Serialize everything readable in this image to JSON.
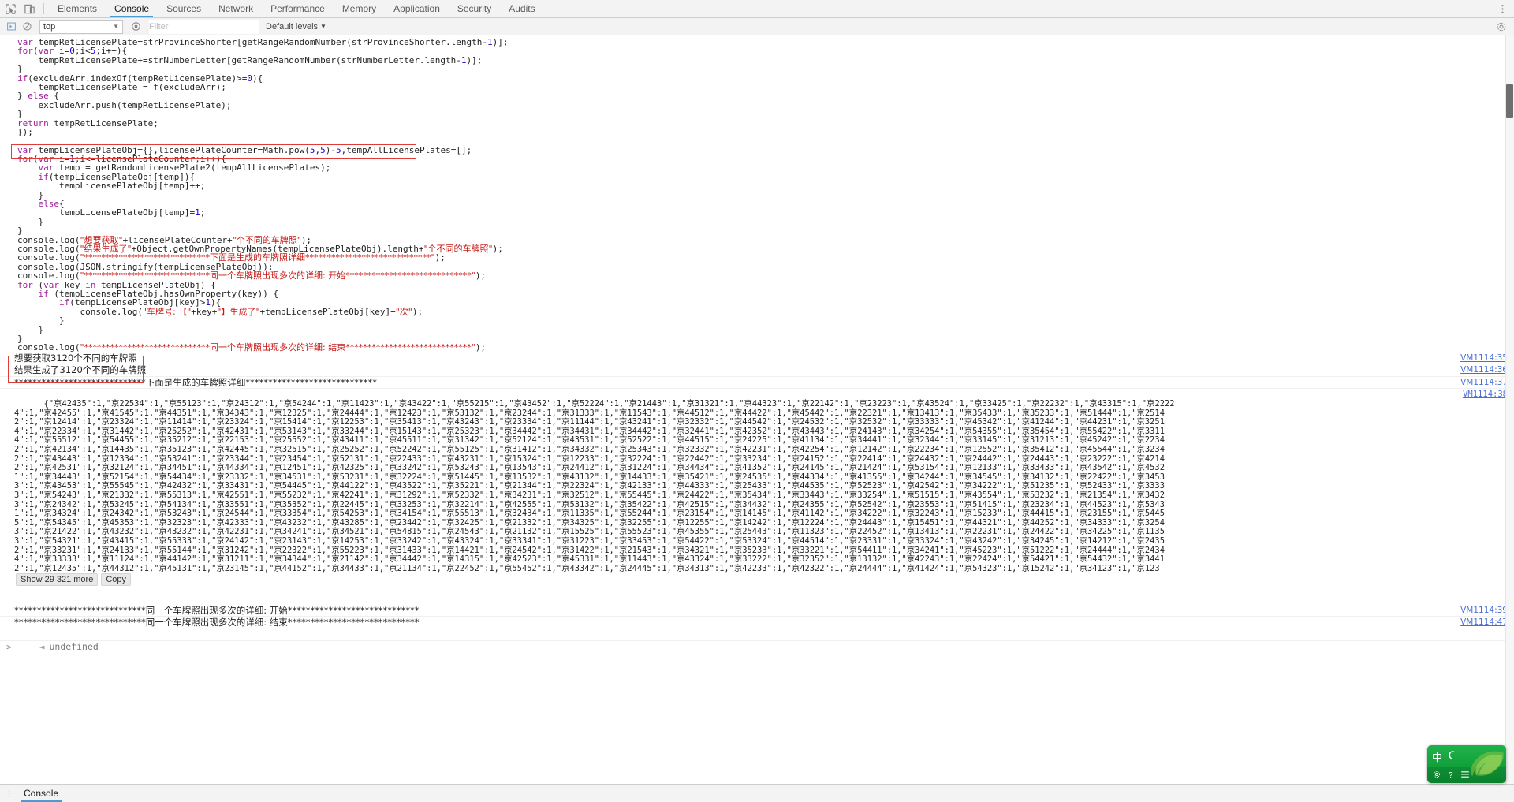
{
  "window": {
    "title": "Chrome DevTools - Console"
  },
  "toolbar_icons": {
    "inspect": "inspect-element-icon",
    "device": "device-toolbar-icon",
    "settings": "gear-icon",
    "more": "more-options-icon"
  },
  "tabs": [
    {
      "label": "Elements",
      "active": false
    },
    {
      "label": "Console",
      "active": true
    },
    {
      "label": "Sources",
      "active": false
    },
    {
      "label": "Network",
      "active": false
    },
    {
      "label": "Performance",
      "active": false
    },
    {
      "label": "Memory",
      "active": false
    },
    {
      "label": "Application",
      "active": false
    },
    {
      "label": "Security",
      "active": false
    },
    {
      "label": "Audits",
      "active": false
    }
  ],
  "console_toolbar": {
    "execute_label": "execute-context-icon",
    "clear_label": "clear-console-icon",
    "context_value": "top",
    "context_options": [
      "top"
    ],
    "eye_label": "live-expression-icon",
    "filter_placeholder": "Filter",
    "filter_value": "",
    "levels_label": "Default levels",
    "levels_caret": "▼",
    "settings_label": "gear-icon"
  },
  "code": {
    "highlight_line_index": 9,
    "lines": [
      [
        {
          "t": "var ",
          "c": "kw"
        },
        {
          "t": "tempRetLicensePlate=strProvinceShorter[getRangeRandomNumber(strProvinceShorter.length-",
          "c": "op"
        },
        {
          "t": "1",
          "c": "num"
        },
        {
          "t": ")];",
          "c": "op"
        }
      ],
      [
        {
          "t": "for",
          "c": "kw"
        },
        {
          "t": "(",
          "c": "op"
        },
        {
          "t": "var ",
          "c": "kw"
        },
        {
          "t": "i=",
          "c": "op"
        },
        {
          "t": "0",
          "c": "num"
        },
        {
          "t": ";i<",
          "c": "op"
        },
        {
          "t": "5",
          "c": "num"
        },
        {
          "t": ";i++){",
          "c": "op"
        }
      ],
      [
        {
          "t": "    tempRetLicensePlate+=strNumberLetter[getRangeRandomNumber(strNumberLetter.length-",
          "c": "op"
        },
        {
          "t": "1",
          "c": "num"
        },
        {
          "t": ")];",
          "c": "op"
        }
      ],
      [
        {
          "t": "}",
          "c": "op"
        }
      ],
      [
        {
          "t": "if",
          "c": "kw"
        },
        {
          "t": "(excludeArr.indexOf(tempRetLicensePlate)>=",
          "c": "op"
        },
        {
          "t": "0",
          "c": "num"
        },
        {
          "t": "){",
          "c": "op"
        }
      ],
      [
        {
          "t": "    tempRetLicensePlate = f(excludeArr);",
          "c": "op"
        }
      ],
      [
        {
          "t": "} ",
          "c": "op"
        },
        {
          "t": "else",
          "c": "kw"
        },
        {
          "t": " {",
          "c": "op"
        }
      ],
      [
        {
          "t": "    excludeArr.push(tempRetLicensePlate);",
          "c": "op"
        }
      ],
      [
        {
          "t": "}",
          "c": "op"
        }
      ],
      [
        {
          "t": "return",
          "c": "kw"
        },
        {
          "t": " tempRetLicensePlate;",
          "c": "op"
        }
      ],
      [
        {
          "t": "});",
          "c": "op"
        }
      ],
      [
        {
          "t": "",
          "c": "op"
        }
      ],
      [
        {
          "t": "var ",
          "c": "kw"
        },
        {
          "t": "tempLicensePlateObj={},licensePlateCounter=Math.pow(",
          "c": "op"
        },
        {
          "t": "5",
          "c": "num"
        },
        {
          "t": ",",
          "c": "op"
        },
        {
          "t": "5",
          "c": "num"
        },
        {
          "t": ")-",
          "c": "op"
        },
        {
          "t": "5",
          "c": "num"
        },
        {
          "t": ",tempAllLicensePlates=[];",
          "c": "op"
        }
      ],
      [
        {
          "t": "for",
          "c": "kw"
        },
        {
          "t": "(",
          "c": "op"
        },
        {
          "t": "var ",
          "c": "kw"
        },
        {
          "t": "i=",
          "c": "op"
        },
        {
          "t": "1",
          "c": "num"
        },
        {
          "t": ";i<=licensePlateCounter;i++){",
          "c": "op"
        }
      ],
      [
        {
          "t": "    ",
          "c": "op"
        },
        {
          "t": "var ",
          "c": "kw"
        },
        {
          "t": "temp = getRandomLicensePlate2(tempAllLicensePlates);",
          "c": "op"
        }
      ],
      [
        {
          "t": "    ",
          "c": "op"
        },
        {
          "t": "if",
          "c": "kw"
        },
        {
          "t": "(tempLicensePlateObj[temp]){",
          "c": "op"
        }
      ],
      [
        {
          "t": "        tempLicensePlateObj[temp]++;",
          "c": "op"
        }
      ],
      [
        {
          "t": "    }",
          "c": "op"
        }
      ],
      [
        {
          "t": "    ",
          "c": "op"
        },
        {
          "t": "else",
          "c": "kw"
        },
        {
          "t": "{",
          "c": "op"
        }
      ],
      [
        {
          "t": "        tempLicensePlateObj[temp]=",
          "c": "op"
        },
        {
          "t": "1",
          "c": "num"
        },
        {
          "t": ";",
          "c": "op"
        }
      ],
      [
        {
          "t": "    }",
          "c": "op"
        }
      ],
      [
        {
          "t": "}",
          "c": "op"
        }
      ],
      [
        {
          "t": "console.log(",
          "c": "op"
        },
        {
          "t": "\"想要获取\"",
          "c": "str"
        },
        {
          "t": "+licensePlateCounter+",
          "c": "op"
        },
        {
          "t": "\"个不同的车牌照\"",
          "c": "str"
        },
        {
          "t": ");",
          "c": "op"
        }
      ],
      [
        {
          "t": "console.log(",
          "c": "op"
        },
        {
          "t": "\"结果生成了\"",
          "c": "str"
        },
        {
          "t": "+Object.getOwnPropertyNames(tempLicensePlateObj).length+",
          "c": "op"
        },
        {
          "t": "\"个不同的车牌照\"",
          "c": "str"
        },
        {
          "t": ");",
          "c": "op"
        }
      ],
      [
        {
          "t": "console.log(",
          "c": "op"
        },
        {
          "t": "\"*****************************下面是生成的车牌照详细*****************************\"",
          "c": "str"
        },
        {
          "t": ");",
          "c": "op"
        }
      ],
      [
        {
          "t": "console.log(JSON.stringify(tempLicensePlateObj));",
          "c": "op"
        }
      ],
      [
        {
          "t": "console.log(",
          "c": "op"
        },
        {
          "t": "\"*****************************同一个车牌照出现多次的详细: 开始*****************************\"",
          "c": "str"
        },
        {
          "t": ");",
          "c": "op"
        }
      ],
      [
        {
          "t": "for",
          "c": "kw"
        },
        {
          "t": " (",
          "c": "op"
        },
        {
          "t": "var ",
          "c": "kw"
        },
        {
          "t": "key ",
          "c": "op"
        },
        {
          "t": "in",
          "c": "kw"
        },
        {
          "t": " tempLicensePlateObj) {",
          "c": "op"
        }
      ],
      [
        {
          "t": "    ",
          "c": "op"
        },
        {
          "t": "if",
          "c": "kw"
        },
        {
          "t": " (tempLicensePlateObj.hasOwnProperty(key)) {",
          "c": "op"
        }
      ],
      [
        {
          "t": "        ",
          "c": "op"
        },
        {
          "t": "if",
          "c": "kw"
        },
        {
          "t": "(tempLicensePlateObj[key]>",
          "c": "op"
        },
        {
          "t": "1",
          "c": "num"
        },
        {
          "t": "){",
          "c": "op"
        }
      ],
      [
        {
          "t": "            console.log(",
          "c": "op"
        },
        {
          "t": "\"车牌号: 【\"",
          "c": "str"
        },
        {
          "t": "+key+",
          "c": "op"
        },
        {
          "t": "\"】生成了\"",
          "c": "str"
        },
        {
          "t": "+tempLicensePlateObj[key]+",
          "c": "op"
        },
        {
          "t": "\"次\"",
          "c": "str"
        },
        {
          "t": ");",
          "c": "op"
        }
      ],
      [
        {
          "t": "        }",
          "c": "op"
        }
      ],
      [
        {
          "t": "    }",
          "c": "op"
        }
      ],
      [
        {
          "t": "}",
          "c": "op"
        }
      ],
      [
        {
          "t": "console.log(",
          "c": "op"
        },
        {
          "t": "\"*****************************同一个车牌照出现多次的详细: 结束*****************************\"",
          "c": "str"
        },
        {
          "t": ");",
          "c": "op"
        }
      ]
    ]
  },
  "messages": [
    {
      "text": "想要获取3120个不同的车牌照",
      "source": "VM1114:35",
      "boxed": true
    },
    {
      "text": "结果生成了3120个不同的车牌照",
      "source": "VM1114:36",
      "boxed": true
    },
    {
      "text": "*****************************下面是生成的车牌照详细*****************************",
      "source": "VM1114:37",
      "boxed": false
    }
  ],
  "json_output": {
    "source": "VM1114:38",
    "show_more_label": "Show 29 321 more",
    "copy_label": "Copy",
    "text": "{\"京42435\":1,\"京22534\":1,\"京55123\":1,\"京24312\":1,\"京54244\":1,\"京11423\":1,\"京43422\":1,\"京55215\":1,\"京43452\":1,\"京52224\":1,\"京21443\":1,\"京31321\":1,\"京44323\":1,\"京22142\":1,\"京23223\":1,\"京43524\":1,\"京33425\":1,\"京22232\":1,\"京43315\":1,\"京22224\":1,\"京42455\":1,\"京41545\":1,\"京44351\":1,\"京34343\":1,\"京12325\":1,\"京24444\":1,\"京12423\":1,\"京53132\":1,\"京23244\":1,\"京31333\":1,\"京11543\":1,\"京44512\":1,\"京44422\":1,\"京45442\":1,\"京22321\":1,\"京13413\":1,\"京35433\":1,\"京35233\":1,\"京51444\":1,\"京25142\":1,\"京12414\":1,\"京23324\":1,\"京11414\":1,\"京23324\":1,\"京15414\":1,\"京12253\":1,\"京35413\":1,\"京43243\":1,\"京23334\":1,\"京11144\":1,\"京43241\":1,\"京32332\":1,\"京44542\":1,\"京24532\":1,\"京32532\":1,\"京33333\":1,\"京45342\":1,\"京41244\":1,\"京44231\":1,\"京32514\":1,\"京22334\":1,\"京31442\":1,\"京25252\":1,\"京42431\":1,\"京53143\":1,\"京33244\":1,\"京15143\":1,\"京25323\":1,\"京34442\":1,\"京34431\":1,\"京34442\":1,\"京32441\":1,\"京42352\":1,\"京43443\":1,\"京24143\":1,\"京34254\":1,\"京54355\":1,\"京35454\":1,\"京55422\":1,\"京33114\":1,\"京55512\":1,\"京54455\":1,\"京35212\":1,\"京22153\":1,\"京25552\":1,\"京43411\":1,\"京45511\":1,\"京31342\":1,\"京52124\":1,\"京43531\":1,\"京52522\":1,\"京44515\":1,\"京24225\":1,\"京41134\":1,\"京34441\":1,\"京32344\":1,\"京33145\":1,\"京31213\":1,\"京45242\":1,\"京22342\":1,\"京42134\":1,\"京14435\":1,\"京35123\":1,\"京42445\":1,\"京32515\":1,\"京25252\":1,\"京52242\":1,\"京55125\":1,\"京31412\":1,\"京34332\":1,\"京25343\":1,\"京32332\":1,\"京42231\":1,\"京42254\":1,\"京12142\":1,\"京22234\":1,\"京12552\":1,\"京35412\":1,\"京45544\":1,\"京32342\":1,\"京43443\":1,\"京12334\":1,\"京53241\":1,\"京23344\":1,\"京23454\":1,\"京52131\":1,\"京22433\":1,\"京43231\":1,\"京15324\":1,\"京12233\":1,\"京32224\":1,\"京22442\":1,\"京33234\":1,\"京24152\":1,\"京22414\":1,\"京24432\":1,\"京24442\":1,\"京24443\":1,\"京23222\":1,\"京42142\":1,\"京42531\":1,\"京32124\":1,\"京34451\":1,\"京44334\":1,\"京12451\":1,\"京42325\":1,\"京33242\":1,\"京53243\":1,\"京13543\":1,\"京24412\":1,\"京31224\":1,\"京34434\":1,\"京41352\":1,\"京24145\":1,\"京21424\":1,\"京53154\":1,\"京12133\":1,\"京33433\":1,\"京43542\":1,\"京45321\":1,\"京34443\":1,\"京52154\":1,\"京54434\":1,\"京23332\":1,\"京34531\":1,\"京53231\":1,\"京32224\":1,\"京51445\":1,\"京13532\":1,\"京43132\":1,\"京14433\":1,\"京35421\":1,\"京24535\":1,\"京44334\":1,\"京41355\":1,\"京34244\":1,\"京34545\":1,\"京34132\":1,\"京22422\":1,\"京34533\":1,\"京43453\":1,\"京55545\":1,\"京42432\":1,\"京33431\":1,\"京54445\":1,\"京44122\":1,\"京43522\":1,\"京35221\":1,\"京21344\":1,\"京22324\":1,\"京42133\":1,\"京44333\":1,\"京25433\":1,\"京44535\":1,\"京52523\":1,\"京42542\":1,\"京34222\":1,\"京51235\":1,\"京52433\":1,\"京33333\":1,\"京54243\":1,\"京21332\":1,\"京55313\":1,\"京42551\":1,\"京55232\":1,\"京42241\":1,\"京31292\":1,\"京52332\":1,\"京34231\":1,\"京32512\":1,\"京55445\":1,\"京24422\":1,\"京35434\":1,\"京33443\":1,\"京33254\":1,\"京51515\":1,\"京43554\":1,\"京53232\":1,\"京21354\":1,\"京34323\":1,\"京24342\":1,\"京53245\":1,\"京54134\":1,\"京33551\":1,\"京35352\":1,\"京22445\":1,\"京33253\":1,\"京32214\":1,\"京42555\":1,\"京53132\":1,\"京35422\":1,\"京42515\":1,\"京34432\":1,\"京24355\":1,\"京52542\":1,\"京23553\":1,\"京51415\":1,\"京23234\":1,\"京44523\":1,\"京53431\":1,\"京34324\":1,\"京24342\":1,\"京53243\":1,\"京24544\":1,\"京33354\":1,\"京54253\":1,\"京34154\":1,\"京55513\":1,\"京32434\":1,\"京11335\":1,\"京55244\":1,\"京23154\":1,\"京14145\":1,\"京41142\":1,\"京34222\":1,\"京32243\":1,\"京15233\":1,\"京44415\":1,\"京23155\":1,\"京54455\":1,\"京54345\":1,\"京45353\":1,\"京32323\":1,\"京42333\":1,\"京43232\":1,\"京43285\":1,\"京23442\":1,\"京32425\":1,\"京21332\":1,\"京34325\":1,\"京32255\":1,\"京12255\":1,\"京14242\":1,\"京12224\":1,\"京24443\":1,\"京15451\":1,\"京44321\":1,\"京44252\":1,\"京34333\":1,\"京32543\":1,\"京21422\":1,\"京43232\":1,\"京43232\":1,\"京42231\":1,\"京34241\":1,\"京34521\":1,\"京54815\":1,\"京24543\":1,\"京21132\":1,\"京15525\":1,\"京55523\":1,\"京45355\":1,\"京25443\":1,\"京11323\":1,\"京22452\":1,\"京13413\":1,\"京22231\":1,\"京24422\":1,\"京34225\":1,\"京11353\":1,\"京54321\":1,\"京43415\":1,\"京55333\":1,\"京24142\":1,\"京23143\":1,\"京14253\":1,\"京33242\":1,\"京43324\":1,\"京33341\":1,\"京31223\":1,\"京33453\":1,\"京54422\":1,\"京53324\":1,\"京44514\":1,\"京23331\":1,\"京33324\":1,\"京43242\":1,\"京34245\":1,\"京14212\":1,\"京24352\":1,\"京33231\":1,\"京24133\":1,\"京55144\":1,\"京31242\":1,\"京22322\":1,\"京55223\":1,\"京31433\":1,\"京14421\":1,\"京24542\":1,\"京31422\":1,\"京21543\":1,\"京34321\":1,\"京35233\":1,\"京33221\":1,\"京54411\":1,\"京34241\":1,\"京45223\":1,\"京51222\":1,\"京24444\":1,\"京24344\":1,\"京33333\":1,\"京11124\":1,\"京44142\":1,\"京31211\":1,\"京34344\":1,\"京21142\":1,\"京34442\":1,\"京14315\":1,\"京42523\":1,\"京45331\":1,\"京11443\":1,\"京43324\":1,\"京33222\":1,\"京32352\":1,\"京13132\":1,\"京42243\":1,\"京22424\":1,\"京54421\":1,\"京54432\":1,\"京34412\":1,\"京12435\":1,\"京44312\":1,\"京45131\":1,\"京23145\":1,\"京44152\":1,\"京34433\":1,\"京21134\":1,\"京22452\":1,\"京55452\":1,\"京43342\":1,\"京24445\":1,\"京34313\":1,\"京42233\":1,\"京42322\":1,\"京24444\":1,\"京41424\":1,\"京54323\":1,\"京15242\":1,\"京34123\":1,\"京123"
  },
  "trailing_messages": [
    {
      "text": "*****************************同一个车牌照出现多次的详细: 开始*****************************",
      "source": "VM1114:39"
    },
    {
      "text": "*****************************同一个车牌照出现多次的详细: 结束*****************************",
      "source": "VM1114:47"
    }
  ],
  "result": {
    "arrow": "◄",
    "value": "undefined"
  },
  "prompt": {
    "symbol": ">",
    "value": ""
  },
  "drawer": {
    "dots": "⋮",
    "tab_label": "Console"
  },
  "ime": {
    "mode_label": "中",
    "moon_icon": "moon-icon",
    "settings_icon": "gear-icon",
    "help_icon": "help-icon",
    "menu_icon": "menu-icon"
  },
  "colors": {
    "accent": "#4a9ad4",
    "highlight_box": "#e03b36",
    "link": "#4a6fd4",
    "string": "#c41a16",
    "keyword": "#a0219b",
    "number": "#1c00cf",
    "ime_green": "#12a03b"
  }
}
